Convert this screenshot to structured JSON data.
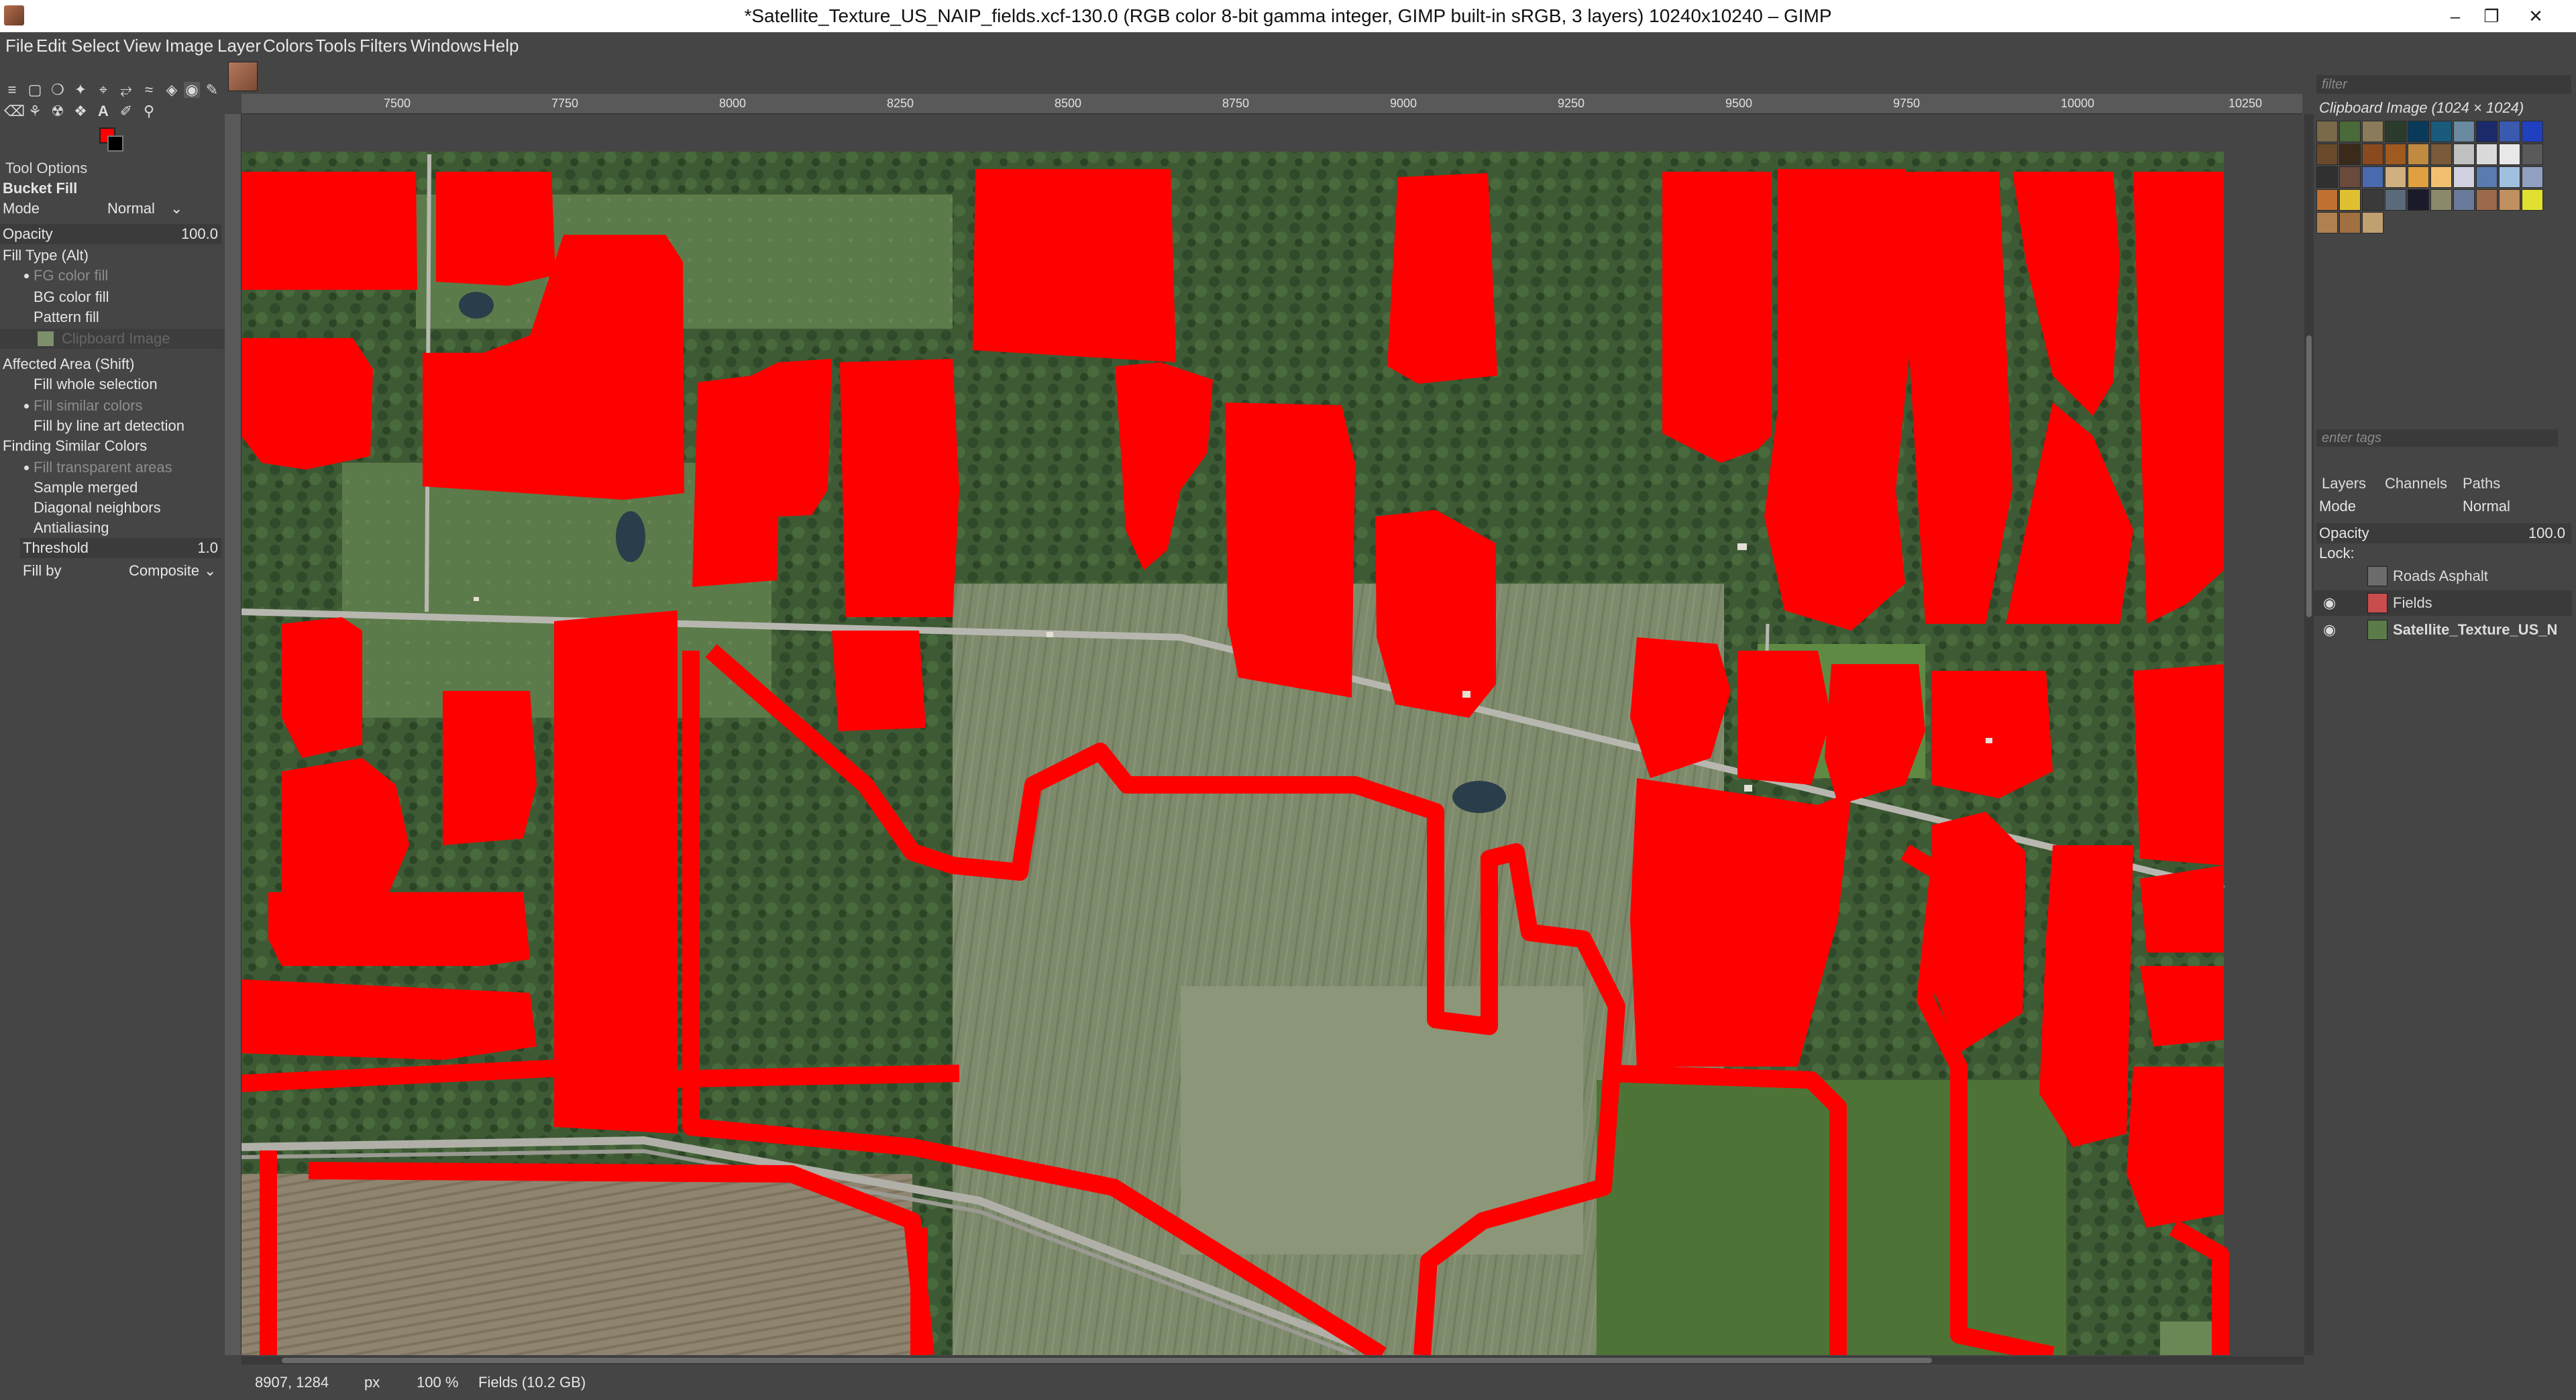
{
  "window": {
    "title": "*Satellite_Texture_US_NAIP_fields.xcf-130.0 (RGB color 8-bit gamma integer, GIMP built-in sRGB, 3 layers) 10240x10240 – GIMP",
    "minimize_icon": "minimize-icon",
    "maximize_icon": "restore-icon",
    "close_icon": "close-icon"
  },
  "menu": [
    "File",
    "Edit",
    "Select",
    "View",
    "Image",
    "Layer",
    "Colors",
    "Tools",
    "Filters",
    "Windows",
    "Help"
  ],
  "colors": {
    "foreground": "#ff0000",
    "background": "#000000",
    "fill_red": "#ff0000"
  },
  "tool_options": {
    "header": "Tool Options",
    "tool_name": "Bucket Fill",
    "mode_label": "Mode",
    "mode_value": "Normal",
    "opacity_label": "Opacity",
    "opacity_value": "100.0",
    "fill_type_label": "Fill Type  (Alt)",
    "fill_types": [
      "FG color fill",
      "BG color fill",
      "Pattern fill"
    ],
    "pattern_name": "Clipboard Image",
    "affected_area_label": "Affected Area  (Shift)",
    "affected_areas": [
      "Fill whole selection",
      "Fill similar colors",
      "Fill by line art detection"
    ],
    "finding_label": "Finding Similar Colors",
    "finding_options": [
      "Fill transparent areas",
      "Sample merged",
      "Diagonal neighbors",
      "Antialiasing"
    ],
    "threshold_label": "Threshold",
    "threshold_value": "1.0",
    "fill_by_label": "Fill by",
    "fill_by_value": "Composite"
  },
  "ruler": {
    "labels": [
      "7500",
      "7750",
      "8000",
      "8250",
      "8500",
      "8750",
      "9000",
      "9250",
      "9500",
      "9750",
      "10000",
      "10250"
    ]
  },
  "status": {
    "coords": "8907, 1284",
    "unit": "px",
    "zoom": "100 %",
    "layer_info": "Fields (10.2 GB)"
  },
  "dock": {
    "filter_placeholder": "filter",
    "pattern_name": "Clipboard Image (1024 × 1024)",
    "tags_placeholder": "enter tags",
    "tabs": [
      "Layers",
      "Channels",
      "Paths"
    ],
    "mode_label": "Mode",
    "mode_value": "Normal",
    "opacity_label": "Opacity",
    "opacity_value": "100.0",
    "lock_label": "Lock:",
    "layers": [
      {
        "name": "Roads Asphalt",
        "visible": false
      },
      {
        "name": "Fields",
        "visible": true
      },
      {
        "name": "Satellite_Texture_US_N",
        "visible": true
      }
    ]
  }
}
